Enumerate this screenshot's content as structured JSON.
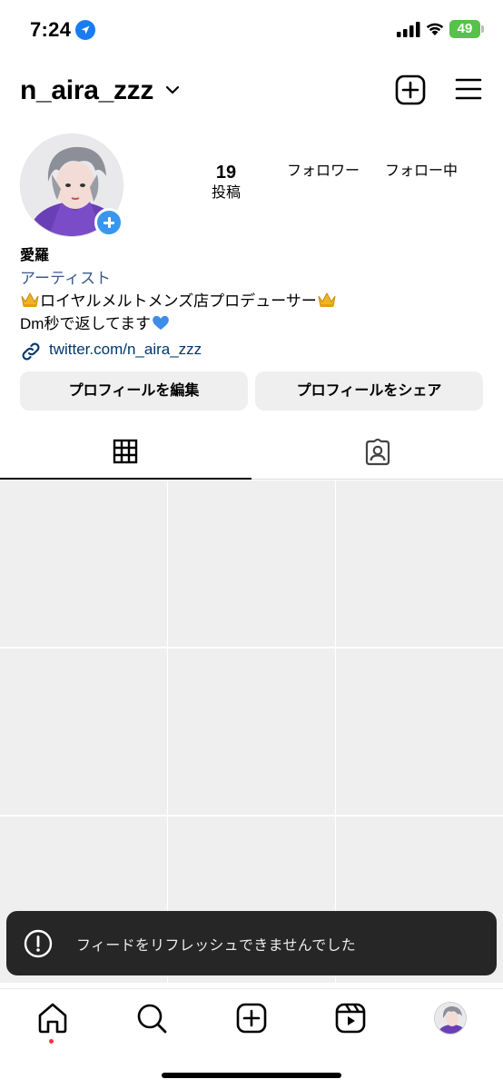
{
  "status_bar": {
    "time": "7:24",
    "battery": "49"
  },
  "header": {
    "username": "n_aira_zzz"
  },
  "profile": {
    "stats": {
      "posts_count": "19",
      "posts_label": "投稿",
      "followers_label": "フォロワー",
      "following_label": "フォロー中"
    },
    "display_name": "愛羅",
    "category": "アーティスト",
    "bio_line1": "ロイヤルメルトメンズ店プロデューサー",
    "bio_line2": "Dm秒で返してます",
    "link": "twitter.com/n_aira_zzz",
    "edit_button": "プロフィールを編集",
    "share_button": "プロフィールをシェア"
  },
  "tabs": [
    "grid-posts",
    "tagged"
  ],
  "grid": {
    "cells": 9
  },
  "toast": {
    "message": "フィードをリフレッシュできませんでした"
  },
  "bottom_nav": [
    "home",
    "search",
    "create",
    "reels",
    "profile"
  ],
  "colors": {
    "accent": "#3797f0",
    "link": "#00376b",
    "category": "#3a5a8a",
    "toast_bg": "#262626",
    "notification_dot": "#ff3040"
  }
}
